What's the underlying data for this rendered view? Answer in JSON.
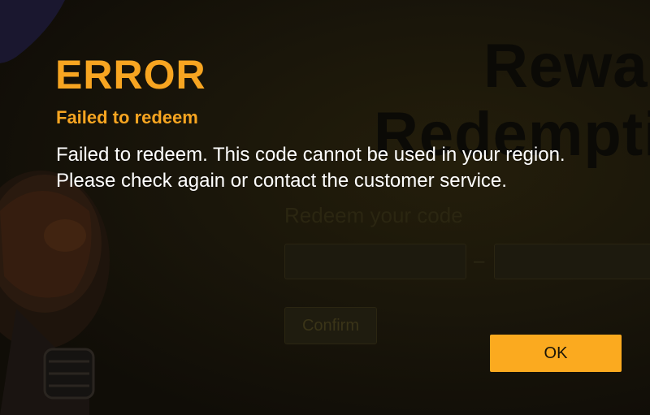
{
  "background": {
    "title_line1": "Rewar",
    "title_line2": "Redemptio",
    "redeem_label": "Redeem your code",
    "code_separator": "–",
    "confirm_label": "Confirm"
  },
  "dialog": {
    "title": "ERROR",
    "subtitle": "Failed to redeem",
    "message": "Failed to redeem. This code cannot be used in your region. Please check again or contact the customer service.",
    "ok_label": "OK"
  },
  "colors": {
    "accent": "#f7a521",
    "button": "#fbaa1f",
    "message_text": "#ffffff",
    "backdrop": "#14110a"
  }
}
